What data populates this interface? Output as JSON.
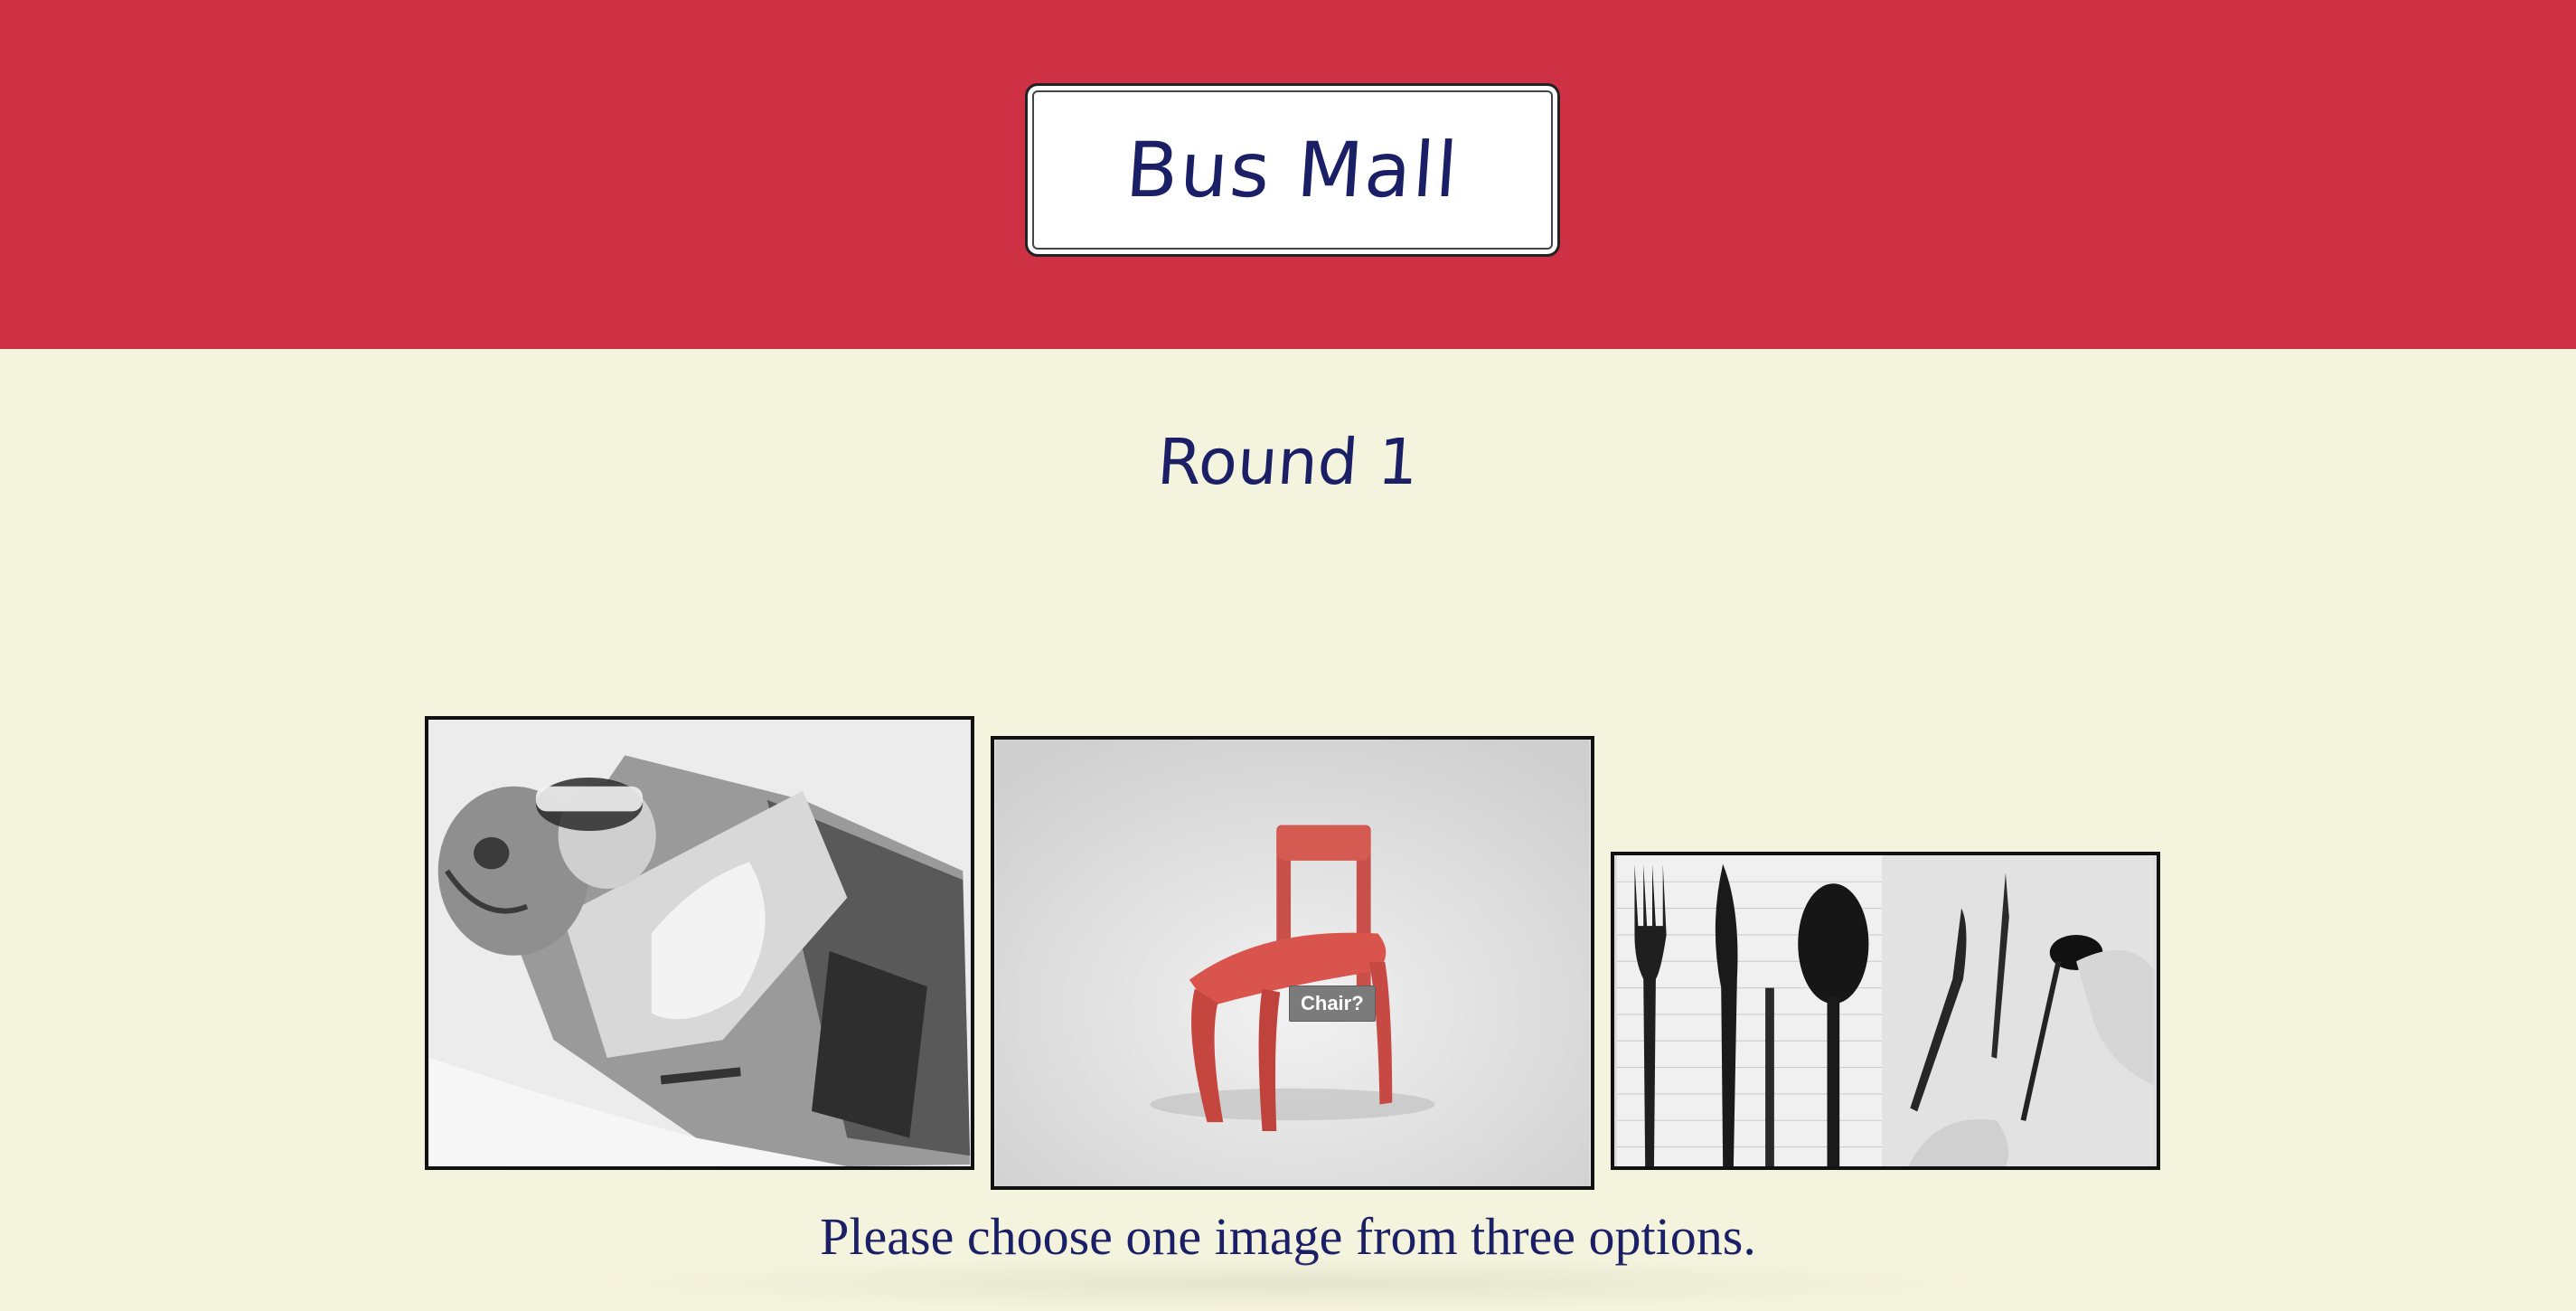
{
  "header": {
    "title": "Bus Mall",
    "background_color": "#cd3143",
    "title_color": "#1a1f66"
  },
  "round": {
    "label": "Round 1"
  },
  "products": [
    {
      "name": "dragon-sleeping-bag",
      "icon": "sleeping-bag-image"
    },
    {
      "name": "chair",
      "icon": "chair-image",
      "tooltip": "Chair?"
    },
    {
      "name": "utensil-pens",
      "icon": "utensil-pens-image"
    }
  ],
  "instructions": "Please choose one image from three options.",
  "page_background": "#f4f3de"
}
